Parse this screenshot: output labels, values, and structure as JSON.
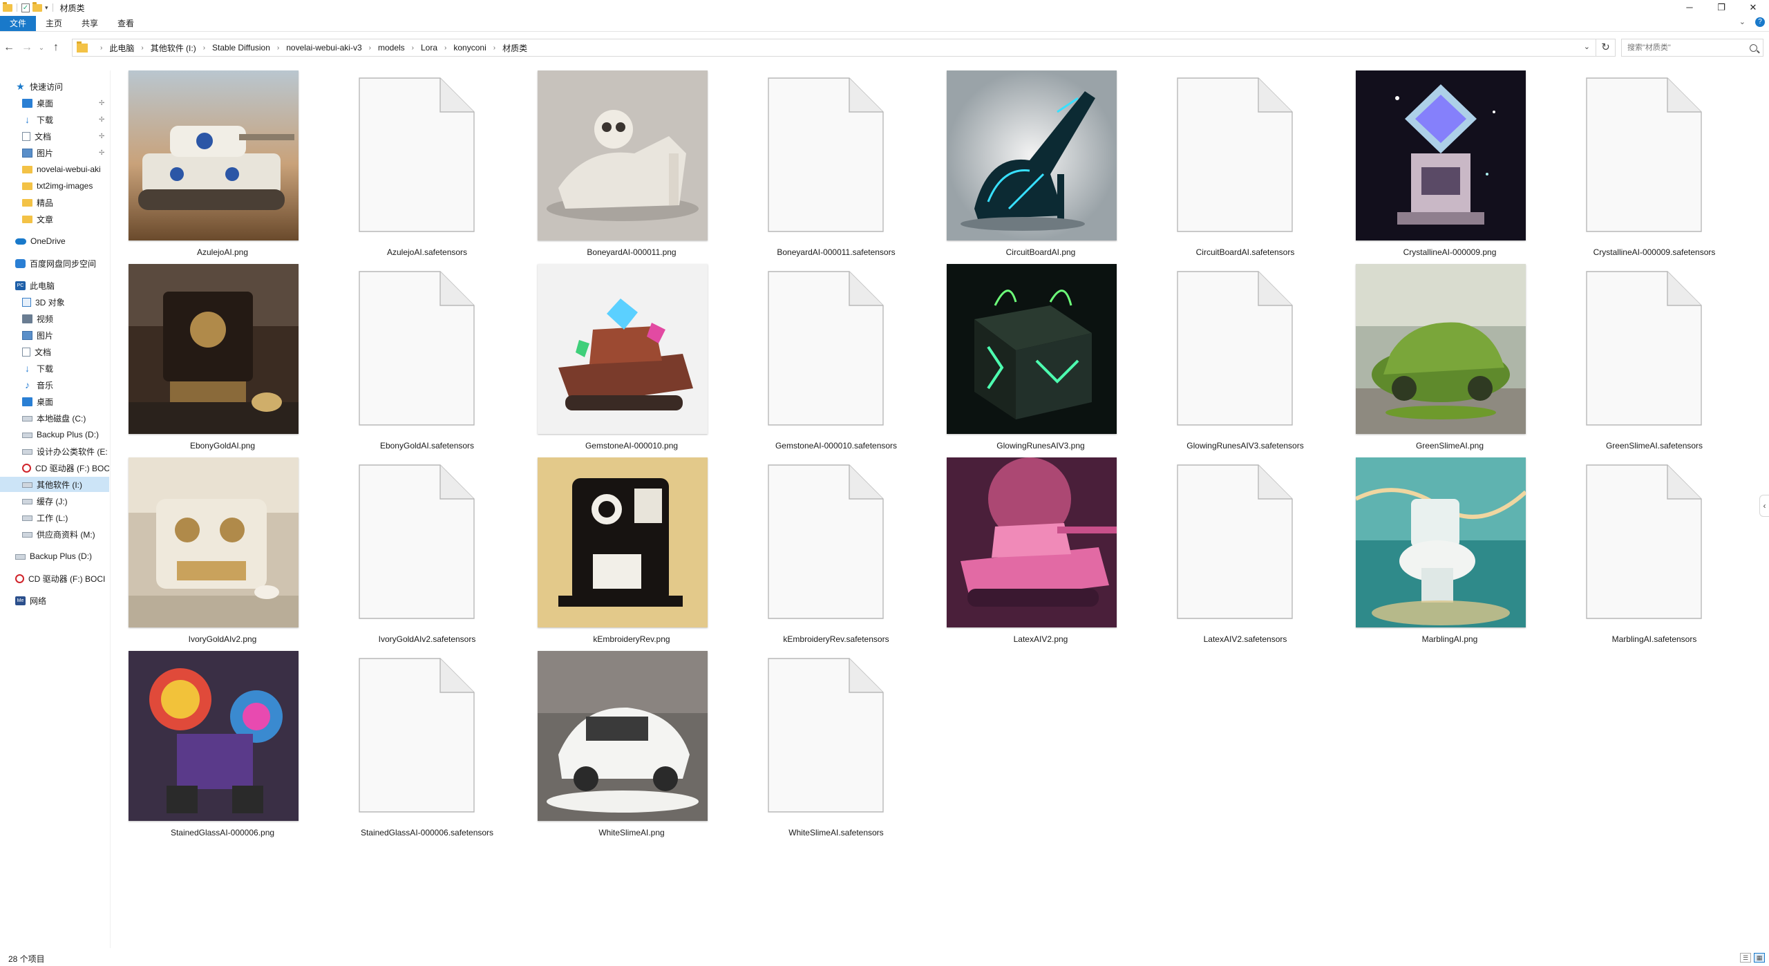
{
  "window": {
    "title": "材质类",
    "controls": {
      "minimize": "─",
      "maximize": "❐",
      "close": "✕"
    }
  },
  "ribbon": {
    "tabs": [
      "文件",
      "主页",
      "共享",
      "查看"
    ],
    "expand_glyph": "⌄",
    "help_glyph": "?"
  },
  "navigation": {
    "back": "←",
    "forward": "→",
    "recent": "⌄",
    "up": "↑",
    "breadcrumbs": [
      "此电脑",
      "其他软件 (I:)",
      "Stable Diffusion",
      "novelai-webui-aki-v3",
      "models",
      "Lora",
      "konyconi",
      "材质类"
    ],
    "crumb_separator": "›",
    "address_dropdown": "⌄",
    "refresh": "↻",
    "search_placeholder": "搜索\"材质类\""
  },
  "sidebar": {
    "items": [
      {
        "label": "快速访问",
        "icon": "star-icon",
        "level": 0
      },
      {
        "label": "桌面",
        "icon": "desktop-icon",
        "level": 1,
        "pinned": true
      },
      {
        "label": "下载",
        "icon": "download-icon",
        "level": 1,
        "pinned": true
      },
      {
        "label": "文档",
        "icon": "document-icon",
        "level": 1,
        "pinned": true
      },
      {
        "label": "图片",
        "icon": "pictures-icon",
        "level": 1,
        "pinned": true
      },
      {
        "label": "novelai-webui-aki",
        "icon": "folder-icon",
        "level": 1
      },
      {
        "label": "txt2img-images",
        "icon": "folder-icon",
        "level": 1
      },
      {
        "label": "精品",
        "icon": "folder-icon",
        "level": 1
      },
      {
        "label": "文章",
        "icon": "folder-icon",
        "level": 1
      },
      {
        "label": "OneDrive",
        "icon": "cloud-icon",
        "level": 0
      },
      {
        "label": "百度网盘同步空间",
        "icon": "baidu-netdisk-icon",
        "level": 0
      },
      {
        "label": "此电脑",
        "icon": "this-pc-icon",
        "level": 0
      },
      {
        "label": "3D 对象",
        "icon": "3d-objects-icon",
        "level": 1
      },
      {
        "label": "视频",
        "icon": "videos-icon",
        "level": 1
      },
      {
        "label": "图片",
        "icon": "pictures-icon",
        "level": 1
      },
      {
        "label": "文档",
        "icon": "document-icon",
        "level": 1
      },
      {
        "label": "下载",
        "icon": "download-icon",
        "level": 1
      },
      {
        "label": "音乐",
        "icon": "music-icon",
        "level": 1
      },
      {
        "label": "桌面",
        "icon": "desktop-icon",
        "level": 1
      },
      {
        "label": "本地磁盘 (C:)",
        "icon": "drive-icon",
        "level": 1
      },
      {
        "label": "Backup Plus (D:)",
        "icon": "drive-icon",
        "level": 1
      },
      {
        "label": "设计办公类软件 (E:",
        "icon": "drive-icon",
        "level": 1
      },
      {
        "label": "CD 驱动器 (F:) BOC",
        "icon": "cd-drive-icon",
        "level": 1
      },
      {
        "label": "其他软件 (I:)",
        "icon": "drive-icon",
        "level": 1,
        "selected": true
      },
      {
        "label": "缓存 (J:)",
        "icon": "drive-icon",
        "level": 1
      },
      {
        "label": "工作 (L:)",
        "icon": "drive-icon",
        "level": 1
      },
      {
        "label": "供应商资料 (M:)",
        "icon": "drive-icon",
        "level": 1
      },
      {
        "label": "Backup Plus (D:)",
        "icon": "drive-icon",
        "level": 0
      },
      {
        "label": "CD 驱动器 (F:) BOCI",
        "icon": "cd-drive-icon",
        "level": 0
      },
      {
        "label": "网络",
        "icon": "network-icon",
        "level": 0
      }
    ]
  },
  "files": [
    {
      "name": "AzulejoAI.png",
      "type": "image",
      "art": "azulejo-tank"
    },
    {
      "name": "AzulejoAI.safetensors",
      "type": "file"
    },
    {
      "name": "BoneyardAI-000011.png",
      "type": "image",
      "art": "bone-shoe"
    },
    {
      "name": "BoneyardAI-000011.safetensors",
      "type": "file"
    },
    {
      "name": "CircuitBoardAI.png",
      "type": "image",
      "art": "circuit-heel"
    },
    {
      "name": "CircuitBoardAI.safetensors",
      "type": "file"
    },
    {
      "name": "CrystallineAI-000009.png",
      "type": "image",
      "art": "crystal-machine"
    },
    {
      "name": "CrystallineAI-000009.safetensors",
      "type": "file"
    },
    {
      "name": "EbonyGoldAI.png",
      "type": "image",
      "art": "ebony-coffee"
    },
    {
      "name": "EbonyGoldAI.safetensors",
      "type": "file"
    },
    {
      "name": "GemstoneAI-000010.png",
      "type": "image",
      "art": "gem-tank"
    },
    {
      "name": "GemstoneAI-000010.safetensors",
      "type": "file"
    },
    {
      "name": "GlowingRunesAIV3.png",
      "type": "image",
      "art": "rune-box"
    },
    {
      "name": "GlowingRunesAIV3.safetensors",
      "type": "file"
    },
    {
      "name": "GreenSlimeAI.png",
      "type": "image",
      "art": "slime-car"
    },
    {
      "name": "GreenSlimeAI.safetensors",
      "type": "file"
    },
    {
      "name": "IvoryGoldAIv2.png",
      "type": "image",
      "art": "ivory-coffee"
    },
    {
      "name": "IvoryGoldAIv2.safetensors",
      "type": "file"
    },
    {
      "name": "kEmbroideryRev.png",
      "type": "image",
      "art": "embroidery-coffee"
    },
    {
      "name": "kEmbroideryRev.safetensors",
      "type": "file"
    },
    {
      "name": "LatexAIV2.png",
      "type": "image",
      "art": "latex-tank"
    },
    {
      "name": "LatexAIV2.safetensors",
      "type": "file"
    },
    {
      "name": "MarblingAI.png",
      "type": "image",
      "art": "marble-toilet"
    },
    {
      "name": "MarblingAI.safetensors",
      "type": "file"
    },
    {
      "name": "StainedGlassAI-000006.png",
      "type": "image",
      "art": "glass-robot"
    },
    {
      "name": "StainedGlassAI-000006.safetensors",
      "type": "file"
    },
    {
      "name": "WhiteSlimeAI.png",
      "type": "image",
      "art": "white-car"
    },
    {
      "name": "WhiteSlimeAI.safetensors",
      "type": "file"
    }
  ],
  "status": {
    "item_count": "28 个项目",
    "view_details": "☰",
    "view_icons": "▦"
  },
  "colors": {
    "accent": "#1979ca",
    "selection": "#cce4f7",
    "folder": "#f3c246"
  }
}
